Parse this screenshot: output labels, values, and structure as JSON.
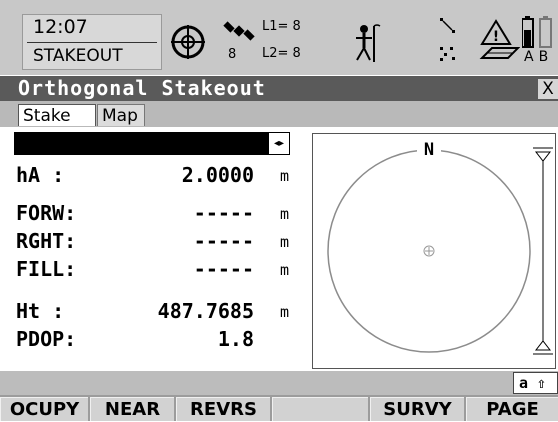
{
  "status": {
    "time": "12:07",
    "mode": "STAKEOUT",
    "sat_count": "8",
    "l1": "L1= 8",
    "l2": "L2= 8",
    "ab": "AB"
  },
  "title": "Orthogonal Stakeout",
  "close_symbol": "X",
  "tabs": [
    {
      "label": "Stake",
      "active": true
    },
    {
      "label": "Map",
      "active": false
    }
  ],
  "selector": {
    "value": "",
    "arrows": "◂▸"
  },
  "fields": [
    {
      "label": "hA   :",
      "value": "2.0000",
      "unit": "m"
    },
    {
      "label": "FORW:",
      "value": "-----",
      "unit": "m"
    },
    {
      "label": "RGHT:",
      "value": "-----",
      "unit": "m"
    },
    {
      "label": "FILL:",
      "value": "-----",
      "unit": "m"
    },
    {
      "label": "Ht   :",
      "value": "487.7685",
      "unit": "m"
    },
    {
      "label": "PDOP:",
      "value": "1.8",
      "unit": ""
    }
  ],
  "graphic": {
    "north_label": "N"
  },
  "input_mode": "a ⇧",
  "fkeys": [
    {
      "label": "OCUPY"
    },
    {
      "label": "NEAR"
    },
    {
      "label": "REVRS"
    },
    {
      "label": ""
    },
    {
      "label": "SURVY"
    },
    {
      "label": "PAGE"
    }
  ],
  "colors": {
    "title_bar": "#5a5a5a",
    "status_bar": "#c8c8c8",
    "fkey_bar": "#9c9c9c",
    "selector": "#000000"
  },
  "icons": [
    "position-icon",
    "satellite-icon",
    "person-icon",
    "line-icon",
    "points-icon",
    "warning-icon",
    "battery-icon"
  ]
}
